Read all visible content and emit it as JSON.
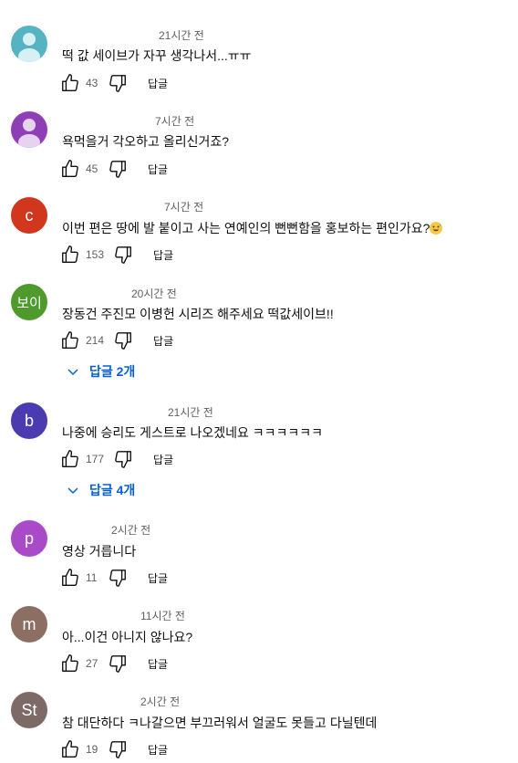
{
  "reply_label": "답글",
  "colors": {
    "link": "#065fd4",
    "meta": "#606060"
  },
  "comments": [
    {
      "avatar_letter": "",
      "avatar_icon": "default-avatar-icon",
      "avatar_color": "#56b3c4",
      "name": "",
      "time": "21시간 전",
      "text": "떡 값 세이브가 자꾸 생각나서...ㅠㅠ",
      "likes": "43"
    },
    {
      "avatar_letter": "",
      "avatar_icon": "default-avatar-icon",
      "avatar_color": "#8e3fb5",
      "name": "",
      "time": "7시간 전",
      "text": "욕먹을거 각오하고 올리신거죠?",
      "likes": "45"
    },
    {
      "avatar_letter": "c",
      "avatar_color": "#d0371d",
      "name": "",
      "time": "7시간 전",
      "text": "이번 편은 땅에 발 붙이고 사는 연예인의 뻔뻔함을 홍보하는 편인가요?",
      "emoji": "grinning-sweat-emoji",
      "likes": "153"
    },
    {
      "avatar_letter": "보이",
      "avatar_color": "#4e9a2c",
      "name": "",
      "time": "20시간 전",
      "text": "장동건 주진모 이병헌 시리즈 해주세요 떡값세이브!!",
      "likes": "214",
      "replies_label": "답글 2개"
    },
    {
      "avatar_letter": "b",
      "avatar_color": "#4b3bb0",
      "name": "",
      "time": "21시간 전",
      "text": "나중에 승리도 게스트로 나오겠네요 ㅋㅋㅋㅋㅋㅋ",
      "likes": "177",
      "replies_label": "답글 4개"
    },
    {
      "avatar_letter": "p",
      "avatar_color": "#a94bc8",
      "name": "",
      "time": "2시간 전",
      "text": "영상 거릅니다",
      "likes": "11"
    },
    {
      "avatar_letter": "m",
      "avatar_color": "#8d6e63",
      "name": "",
      "time": "11시간 전",
      "text": "아...이건 아니지 않나요?",
      "likes": "27"
    },
    {
      "avatar_letter": "St",
      "avatar_color": "#7d6a66",
      "name": "",
      "time": "2시간 전",
      "text": "참 대단하다 ㅋ나갈으면 부끄러워서 얼굴도 못들고 다닐텐데",
      "likes": "19"
    }
  ]
}
